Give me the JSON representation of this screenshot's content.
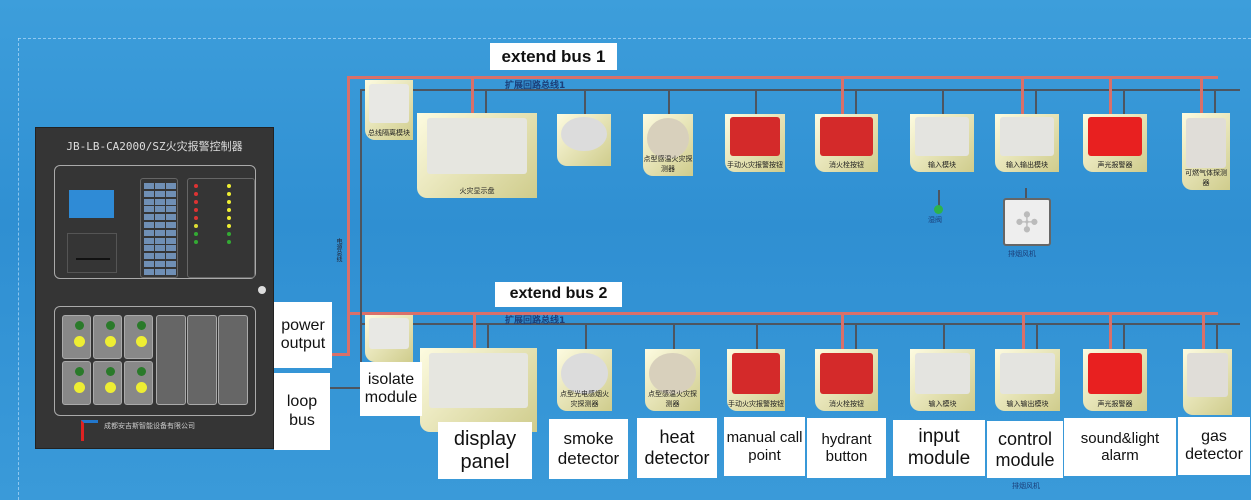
{
  "controller": {
    "title": "JB-LB-CA2000/SZ火灾报警控制器",
    "maker": "成都安吉斯智能设备有限公司"
  },
  "labels": {
    "extend_bus_1": "extend bus 1",
    "extend_bus_2": "extend bus 2",
    "bus1_cn": "扩展回路总线1",
    "bus2_cn": "扩展回路总线1",
    "power_output": "power output",
    "loop_bus": "loop bus",
    "isolate_module": "isolate module",
    "power_line_cn": "电源总线"
  },
  "devices_top": [
    {
      "id": "isolate",
      "cn": "总线隔离模块",
      "color": "#e8e8e4"
    },
    {
      "id": "display",
      "cn": "火灾显示盘",
      "color": "#e6e6e0"
    },
    {
      "id": "smoke",
      "cn": "",
      "color": "#dcdcdc"
    },
    {
      "id": "heat",
      "cn": "点型感温火灾探测器",
      "color": "#d8d0bc"
    },
    {
      "id": "manual",
      "cn": "手动火灾报警按钮",
      "color": "#d42a2a"
    },
    {
      "id": "hydrant",
      "cn": "消火栓按钮",
      "color": "#d42a2a"
    },
    {
      "id": "input",
      "cn": "输入模块",
      "color": "#e4e4e0"
    },
    {
      "id": "control",
      "cn": "输入输出模块",
      "color": "#e4e4e0"
    },
    {
      "id": "sound",
      "cn": "声光报警器",
      "color": "#e82020"
    },
    {
      "id": "gas",
      "cn": "可燃气体探测器",
      "color": "#e0ddd8"
    }
  ],
  "devices_bottom": [
    {
      "id": "isolate",
      "cn": "",
      "en": "",
      "color": "#e8e8e4"
    },
    {
      "id": "display",
      "cn": "",
      "en": "display panel",
      "color": "#e6e6e0"
    },
    {
      "id": "smoke",
      "cn": "点型光电感烟火灾探测器",
      "en": "smoke detector",
      "color": "#dcdcdc"
    },
    {
      "id": "heat",
      "cn": "点型感温火灾探测器",
      "en": "heat detector",
      "color": "#d8d0bc"
    },
    {
      "id": "manual",
      "cn": "手动火灾报警按钮",
      "en": "manual call point",
      "color": "#d42a2a"
    },
    {
      "id": "hydrant",
      "cn": "消火栓按钮",
      "en": "hydrant button",
      "color": "#d42a2a"
    },
    {
      "id": "input",
      "cn": "输入模块",
      "en": "input module",
      "color": "#e4e4e0"
    },
    {
      "id": "control",
      "cn": "输入输出模块",
      "en": "control module",
      "color": "#e4e4e0"
    },
    {
      "id": "sound",
      "cn": "声光报警器",
      "en": "sound&light alarm",
      "color": "#e82020"
    },
    {
      "id": "gas",
      "cn": "",
      "en": "gas detector",
      "color": "#e0ddd8"
    }
  ],
  "extras": {
    "valve_cn": "湿阀",
    "fan_cn": "排烟风机",
    "fan_cn_bottom": "排烟风机"
  },
  "colors": {
    "power_bus": "#d9706a",
    "signal_bus": "#4d5560",
    "background": "#3596d6"
  }
}
